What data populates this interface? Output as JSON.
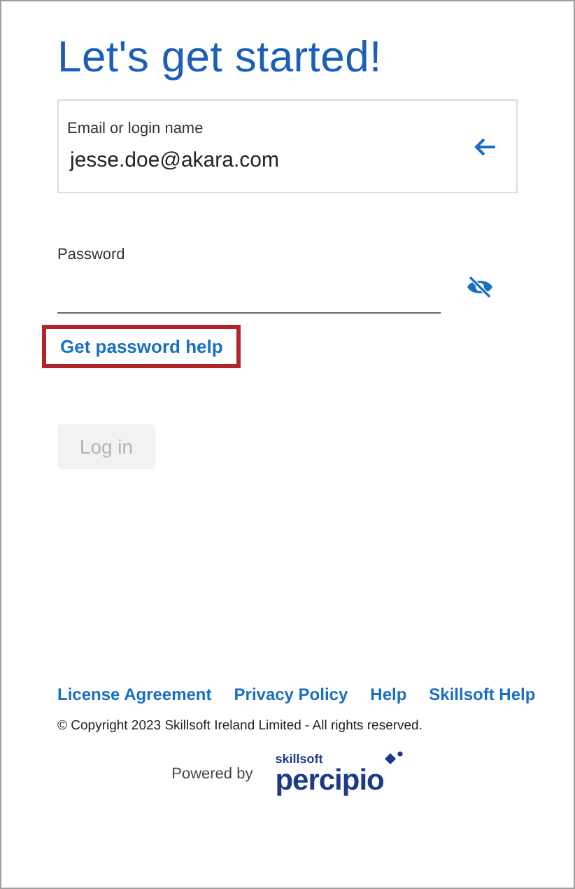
{
  "title": "Let's get started!",
  "email_field": {
    "label": "Email or login name",
    "value": "jesse.doe@akara.com"
  },
  "password_field": {
    "label": "Password",
    "masked": true
  },
  "help_link": {
    "label": "Get password help",
    "highlighted": true
  },
  "login_button": {
    "label": "Log in",
    "disabled": true
  },
  "footer_links": [
    "License Agreement",
    "Privacy Policy",
    "Help",
    "Skillsoft Help"
  ],
  "copyright": "© Copyright 2023 Skillsoft Ireland Limited - All rights reserved.",
  "powered_by": {
    "label": "Powered by",
    "logo_small": "skillsoft",
    "logo_large": "percipio"
  }
}
